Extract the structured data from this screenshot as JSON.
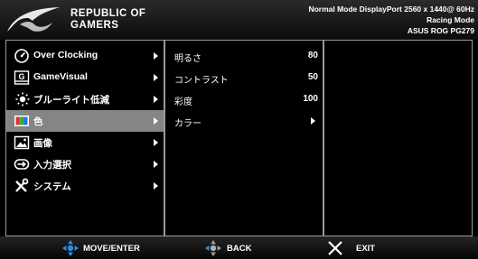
{
  "brand": {
    "line1": "REPUBLIC OF",
    "line2": "GAMERS"
  },
  "status": {
    "line1": "Normal Mode DisplayPort 2560 x 1440@ 60Hz",
    "line2": "Racing Mode",
    "line3": "ASUS ROG PG279"
  },
  "main_menu": [
    {
      "label": "Over Clocking",
      "icon": "speedometer-icon",
      "selected": false
    },
    {
      "label": "GameVisual",
      "icon": "gamevisual-icon",
      "selected": false
    },
    {
      "label": "ブルーライト低減",
      "icon": "bluelight-icon",
      "selected": false
    },
    {
      "label": "色",
      "icon": "color-icon",
      "selected": true
    },
    {
      "label": "画像",
      "icon": "image-icon",
      "selected": false
    },
    {
      "label": "入力選択",
      "icon": "input-icon",
      "selected": false
    },
    {
      "label": "システム",
      "icon": "system-icon",
      "selected": false
    }
  ],
  "sub_menu": [
    {
      "label": "明るさ",
      "value": "80"
    },
    {
      "label": "コントラスト",
      "value": "50"
    },
    {
      "label": "彩度",
      "value": "100"
    },
    {
      "label": "カラー",
      "value": ""
    }
  ],
  "footer": {
    "move_enter": "MOVE/ENTER",
    "back": "BACK",
    "exit": "EXIT"
  },
  "colors": {
    "selected_bg": "#858585",
    "accent_blue": "#2f8fe0"
  }
}
